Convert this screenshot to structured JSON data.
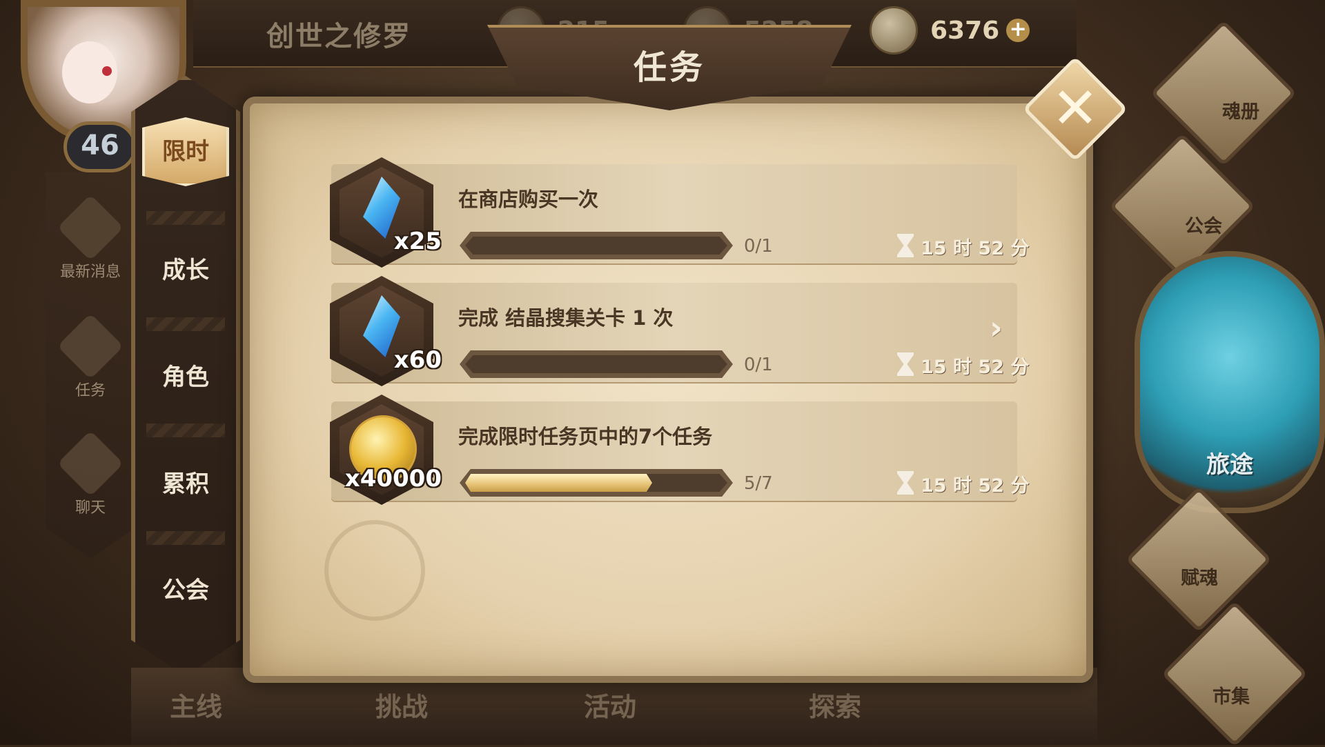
{
  "header": {
    "player_name": "创世之修罗",
    "currency_gem": "6376",
    "currency_gem_add": "+",
    "currency_coin_obscured": "215",
    "currency_crystal_obscured": "5258"
  },
  "player": {
    "level": "46"
  },
  "left_menu": [
    {
      "label": "最新消息",
      "icon": "scroll-icon"
    },
    {
      "label": "任务",
      "icon": "shield-icon"
    },
    {
      "label": "聊天",
      "icon": "chat-icon"
    }
  ],
  "categories": [
    {
      "label": "限时",
      "active": true
    },
    {
      "label": "成长",
      "active": false
    },
    {
      "label": "角色",
      "active": false
    },
    {
      "label": "累积",
      "active": false
    },
    {
      "label": "公会",
      "active": false
    }
  ],
  "panel": {
    "title": "任务",
    "close_label": "✕"
  },
  "quests": [
    {
      "title": "在商店购买一次",
      "reward_icon": "crystal-icon",
      "reward_qty": "x25",
      "progress_text": "0/1",
      "progress": 0,
      "timer": "15 时 52 分"
    },
    {
      "title": "完成 结晶搜集关卡 1 次",
      "reward_icon": "crystal-icon",
      "reward_qty": "x60",
      "progress_text": "0/1",
      "progress": 0,
      "timer": "15 时 52 分",
      "has_arrow": true,
      "arrow": "›"
    },
    {
      "title": "完成限时任务页中的7个任务",
      "reward_icon": "coin-icon",
      "reward_qty": "x40000",
      "progress_text": "5/7",
      "progress": 0.714,
      "timer": "15 时 52 分"
    }
  ],
  "right_menu": {
    "items": [
      {
        "label": "魂册",
        "icon": "helmet-icon"
      },
      {
        "label": "公会",
        "icon": "banner-icon"
      },
      {
        "label": "旅途",
        "icon": "compass-icon"
      },
      {
        "label": "赋魂",
        "icon": "flame-icon"
      },
      {
        "label": "市集",
        "icon": "gem-icon"
      }
    ]
  },
  "bottom_nav": {
    "tabs": [
      "主线",
      "挑战",
      "活动",
      "探索"
    ]
  },
  "colors": {
    "accent_gold": "#d4a968",
    "parchment": "#e5d1ad",
    "text_dark": "#4a3624"
  }
}
